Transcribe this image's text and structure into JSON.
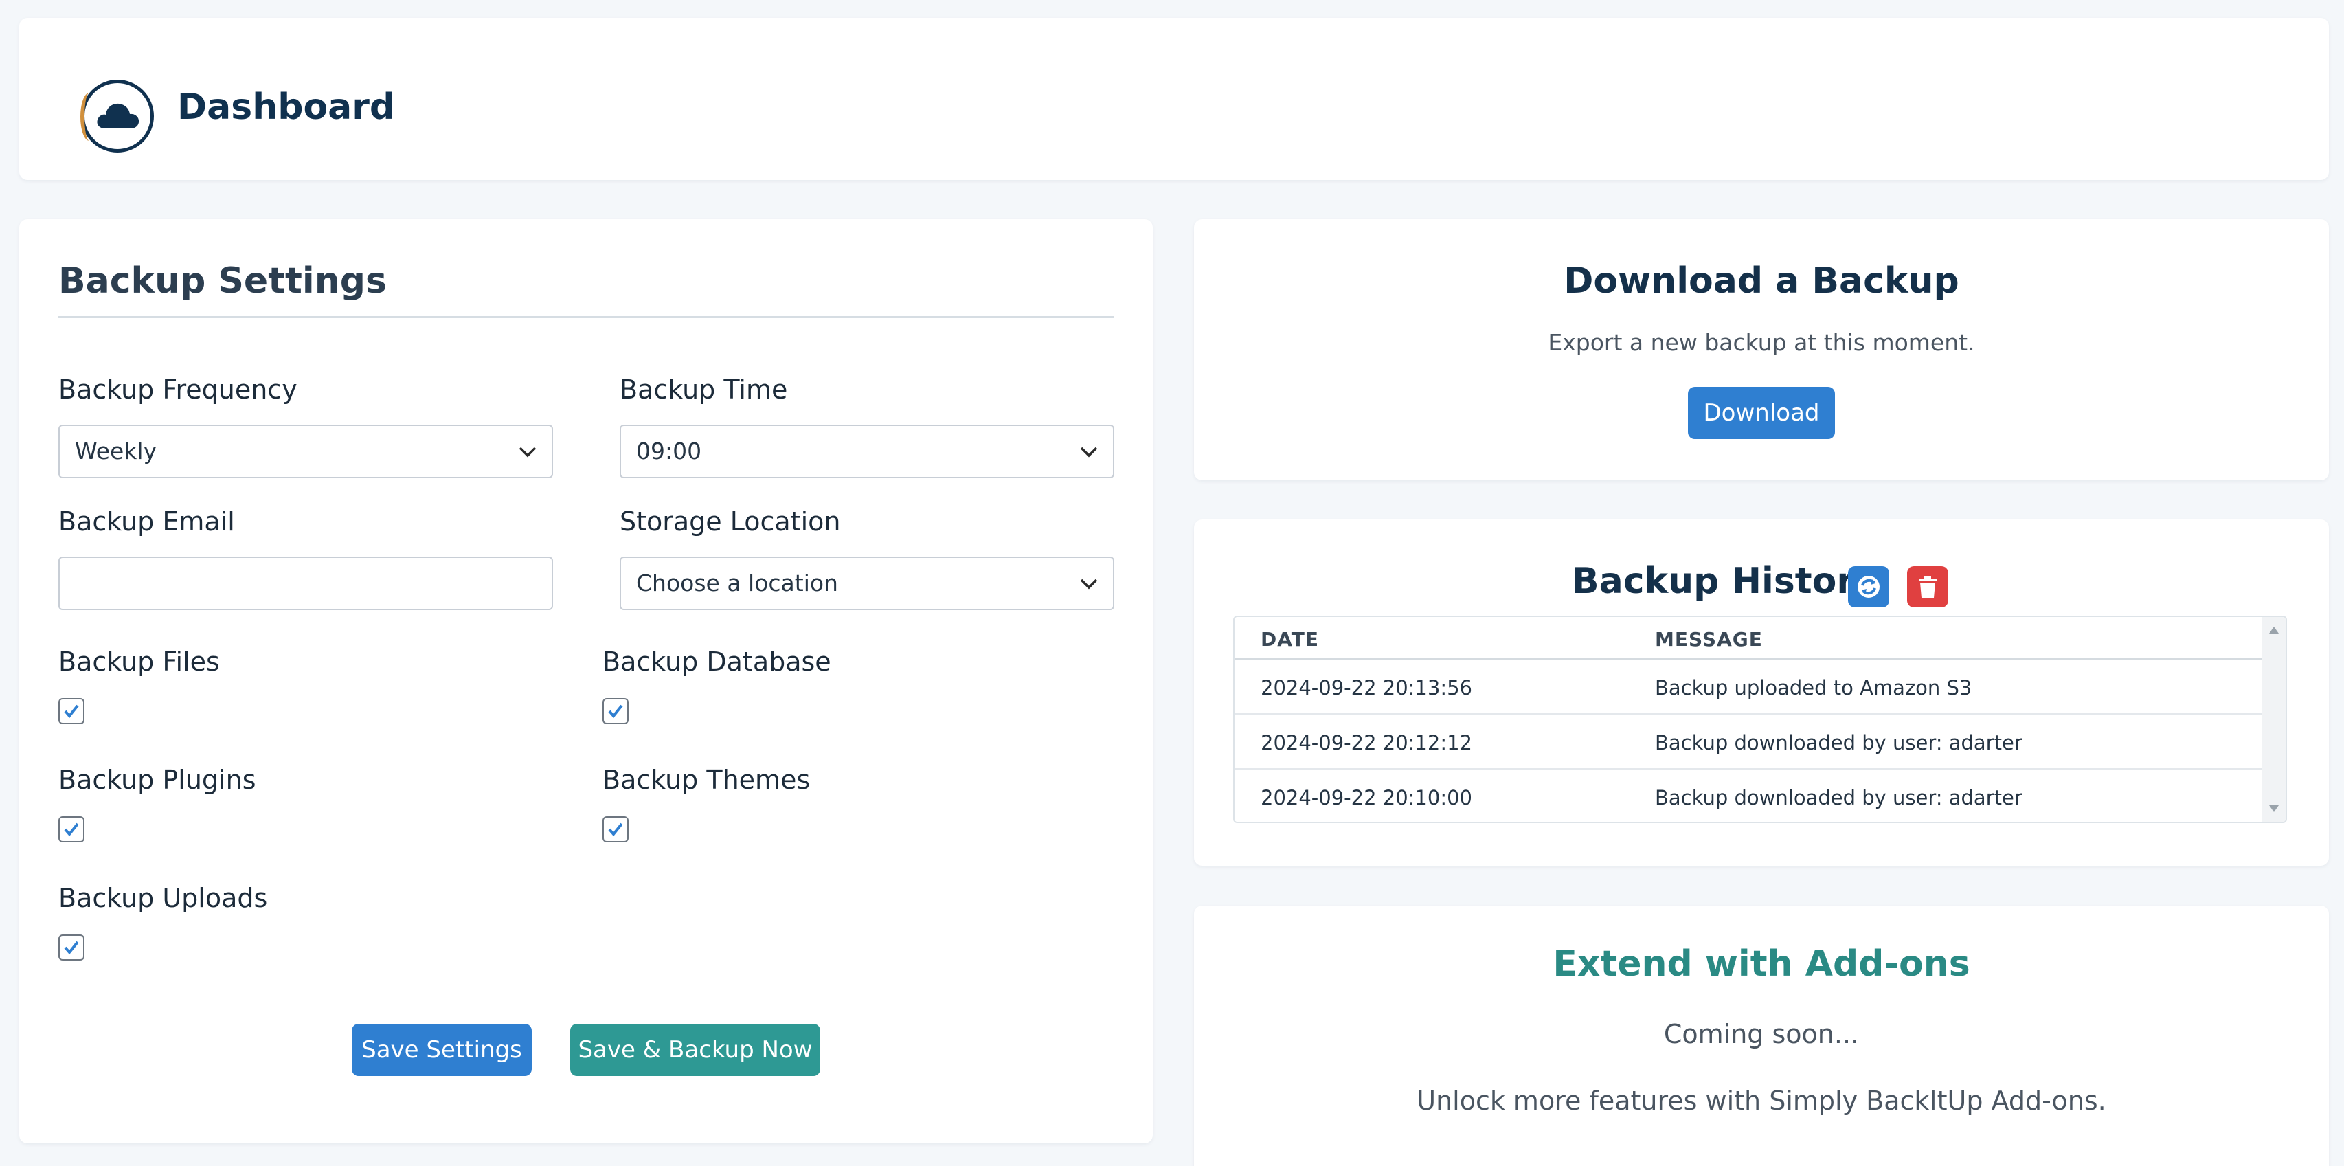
{
  "header": {
    "title": "Dashboard",
    "logo_icon": "cloud-icon"
  },
  "settings": {
    "heading": "Backup Settings",
    "frequency": {
      "label": "Backup Frequency",
      "value": "Weekly"
    },
    "time": {
      "label": "Backup Time",
      "value": "09:00"
    },
    "email": {
      "label": "Backup Email",
      "value": ""
    },
    "storage": {
      "label": "Storage Location",
      "value": "Choose a location"
    },
    "files": {
      "label": "Backup Files",
      "checked": true
    },
    "database": {
      "label": "Backup Database",
      "checked": true
    },
    "plugins": {
      "label": "Backup Plugins",
      "checked": true
    },
    "themes": {
      "label": "Backup Themes",
      "checked": true
    },
    "uploads": {
      "label": "Backup Uploads",
      "checked": true
    },
    "save_label": "Save Settings",
    "save_backup_label": "Save & Backup Now"
  },
  "download": {
    "heading": "Download a Backup",
    "subtitle": "Export a new backup at this moment.",
    "button_label": "Download"
  },
  "history": {
    "heading": "Backup History",
    "columns": [
      "DATE",
      "MESSAGE"
    ],
    "rows": [
      {
        "date": "2024-09-22 20:13:56",
        "message": "Backup uploaded to Amazon S3"
      },
      {
        "date": "2024-09-22 20:12:12",
        "message": "Backup downloaded by user: adarter"
      },
      {
        "date": "2024-09-22 20:10:00",
        "message": "Backup downloaded by user: adarter"
      }
    ]
  },
  "addons": {
    "heading": "Extend with Add-ons",
    "coming_soon": "Coming soon...",
    "description": "Unlock more features with Simply BackItUp Add-ons."
  },
  "colors": {
    "primary": "#2f7fd1",
    "teal": "#2e9994",
    "danger": "#e04040",
    "navy": "#10314f"
  }
}
